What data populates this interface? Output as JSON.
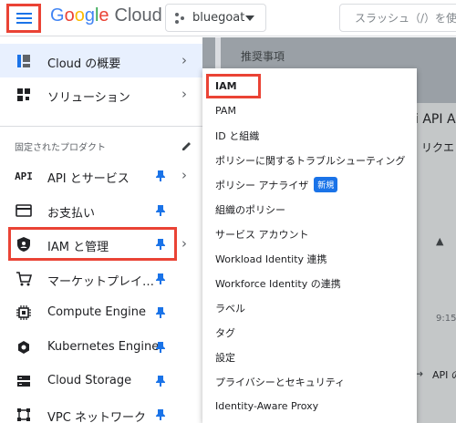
{
  "header": {
    "logo_parts": [
      "G",
      "o",
      "o",
      "g",
      "l",
      "e"
    ],
    "logo_cloud": "Cloud",
    "project_name": "bluegoat",
    "search_placeholder": "スラッシュ（/）を使"
  },
  "nav": {
    "top_items": [
      {
        "label": "Cloud の概要",
        "icon": "dashboard-icon"
      },
      {
        "label": "ソリューション",
        "icon": "solutions-icon"
      }
    ],
    "pinned_section_label": "固定されたプロダクト",
    "pinned_items": [
      {
        "label": "API とサービス",
        "icon": "api-icon"
      },
      {
        "label": "お支払い",
        "icon": "billing-icon"
      },
      {
        "label": "IAM と管理",
        "icon": "iam-shield-icon"
      },
      {
        "label": "マーケットプレイ…",
        "icon": "cart-icon"
      },
      {
        "label": "Compute Engine",
        "icon": "chip-icon"
      },
      {
        "label": "Kubernetes Engine",
        "icon": "kubernetes-icon"
      },
      {
        "label": "Cloud Storage",
        "icon": "storage-icon"
      },
      {
        "label": "VPC ネットワーク",
        "icon": "vpc-network-icon"
      }
    ]
  },
  "submenu": {
    "items": [
      {
        "label": "IAM"
      },
      {
        "label": "PAM"
      },
      {
        "label": "ID と組織"
      },
      {
        "label": "ポリシーに関するトラブルシューティング"
      },
      {
        "label": "ポリシー アナライザ",
        "badge": "新規"
      },
      {
        "label": "組織のポリシー"
      },
      {
        "label": "サービス アカウント"
      },
      {
        "label": "Workload Identity 連携"
      },
      {
        "label": "Workforce Identity の連携"
      },
      {
        "label": "ラベル"
      },
      {
        "label": "タグ"
      },
      {
        "label": "設定"
      },
      {
        "label": "プライバシーとセキュリティ"
      },
      {
        "label": "Identity-Aware Proxy"
      }
    ]
  },
  "main": {
    "recommendations_title": "推奨事項",
    "peek_api": "i API AP",
    "peek_request": "リクエ",
    "peek_time": "9:15",
    "peek_api_link": "API の"
  },
  "colors": {
    "highlight": "#ea4335",
    "accent": "#1a73e8",
    "active_bg": "#e8f0fe"
  }
}
